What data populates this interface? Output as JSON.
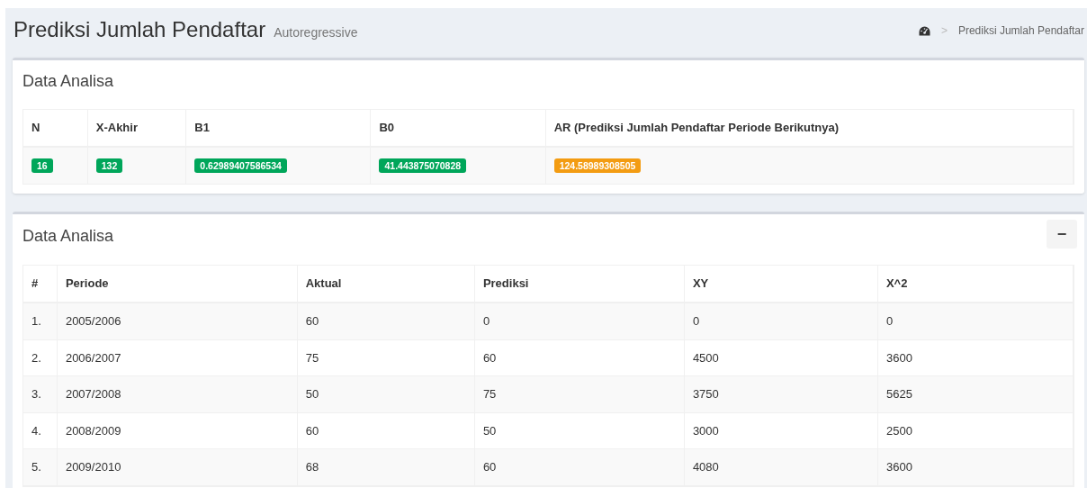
{
  "header": {
    "title": "Prediksi Jumlah Pendaftar",
    "subtitle": "Autoregressive",
    "breadcrumb": [
      {
        "kind": "icon"
      },
      {
        "kind": "text",
        "label": "Prediksi Jumlah Pendaftar"
      }
    ],
    "separator": ">"
  },
  "summary": {
    "title": "Data Analisa",
    "columns": [
      "N",
      "X-Akhir",
      "B1",
      "B0",
      "AR (Prediksi Jumlah Pendaftar Periode Berikutnya)"
    ],
    "values": [
      {
        "text": "16",
        "color": "#00a65a"
      },
      {
        "text": "132",
        "color": "#00a65a"
      },
      {
        "text": "0.62989407586534",
        "color": "#00a65a"
      },
      {
        "text": "41.443875070828",
        "color": "#00a65a"
      },
      {
        "text": "124.58989308505",
        "color": "#f39c12"
      }
    ]
  },
  "analysis": {
    "title": "Data Analisa",
    "collapse_button": "−",
    "columns": [
      "#",
      "Periode",
      "Aktual",
      "Prediksi",
      "XY",
      "X^2"
    ],
    "rows": [
      [
        "1.",
        "2005/2006",
        "60",
        "0",
        "0",
        "0"
      ],
      [
        "2.",
        "2006/2007",
        "75",
        "60",
        "4500",
        "3600"
      ],
      [
        "3.",
        "2007/2008",
        "50",
        "75",
        "3750",
        "5625"
      ],
      [
        "4.",
        "2008/2009",
        "60",
        "50",
        "3000",
        "2500"
      ],
      [
        "5.",
        "2009/2010",
        "68",
        "60",
        "4080",
        "3600"
      ]
    ]
  }
}
